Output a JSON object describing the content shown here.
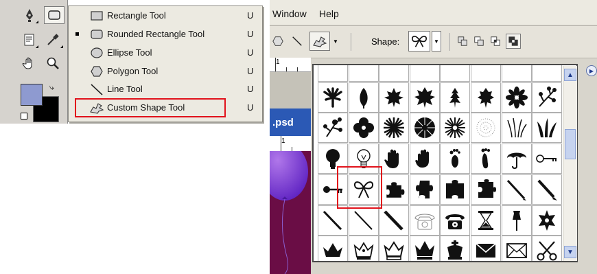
{
  "flyout": {
    "items": [
      {
        "label": "Rectangle Tool",
        "key": "U",
        "icon": "rectangle-icon",
        "active": false
      },
      {
        "label": "Rounded Rectangle Tool",
        "key": "U",
        "icon": "rounded-rectangle-icon",
        "active": true
      },
      {
        "label": "Ellipse Tool",
        "key": "U",
        "icon": "ellipse-icon",
        "active": false
      },
      {
        "label": "Polygon Tool",
        "key": "U",
        "icon": "polygon-icon",
        "active": false
      },
      {
        "label": "Line Tool",
        "key": "U",
        "icon": "line-icon",
        "active": false
      },
      {
        "label": "Custom Shape Tool",
        "key": "U",
        "icon": "custom-shape-icon",
        "active": false
      }
    ]
  },
  "menubar": {
    "window": "Window",
    "help": "Help"
  },
  "options": {
    "shape_label": "Shape:"
  },
  "document": {
    "tab_text": ".psd",
    "ruler_start": "1",
    "ruler2_start": "1"
  },
  "colors": {
    "highlight": "#e1121b",
    "foreground": "#8e9ad0",
    "background": "#000000"
  },
  "shape_grid": {
    "rows": [
      [
        "partial-cloud-icon",
        "partial-shape-icon",
        "partial-shape-icon",
        "partial-shape-icon",
        "partial-shape-icon",
        "partial-shape-icon",
        "partial-shape-icon",
        "partial-shape-icon"
      ],
      [
        "leaf-palm-icon",
        "leaf-icon",
        "maple-leaf-icon",
        "maple-leaf-2-icon",
        "leaf-3-icon",
        "leaf-4-icon",
        "flower-5-icon",
        "flower-branch-icon"
      ],
      [
        "flower-sprig-icon",
        "flower-4petal-icon",
        "starburst-icon",
        "flower-daisy-icon",
        "flower-dots-icon",
        "flower-outline-icon",
        "grass-icon",
        "grass-2-icon"
      ],
      [
        "lightbulb-icon",
        "lightbulb-outline-icon",
        "hand-icon",
        "hand-2-icon",
        "footprint-icon",
        "footprint-2-icon",
        "umbrella-icon",
        "key-icon"
      ],
      [
        "key-2-icon",
        "bow-icon",
        "puzzle-icon",
        "puzzle-2-icon",
        "puzzle-3-icon",
        "puzzle-4-icon",
        "pen-icon",
        "pencil-icon"
      ],
      [
        "pen-2-icon",
        "pencil-2-icon",
        "pencil-3-icon",
        "telephone-outline-icon",
        "telephone-icon",
        "hourglass-icon",
        "pushpin-icon",
        "sheriff-badge-icon"
      ],
      [
        "crown-icon",
        "crown-2-icon",
        "crown-3-icon",
        "crown-4-icon",
        "crown-5-icon",
        "envelope-icon",
        "envelope-outline-icon",
        "scissors-icon"
      ]
    ]
  }
}
